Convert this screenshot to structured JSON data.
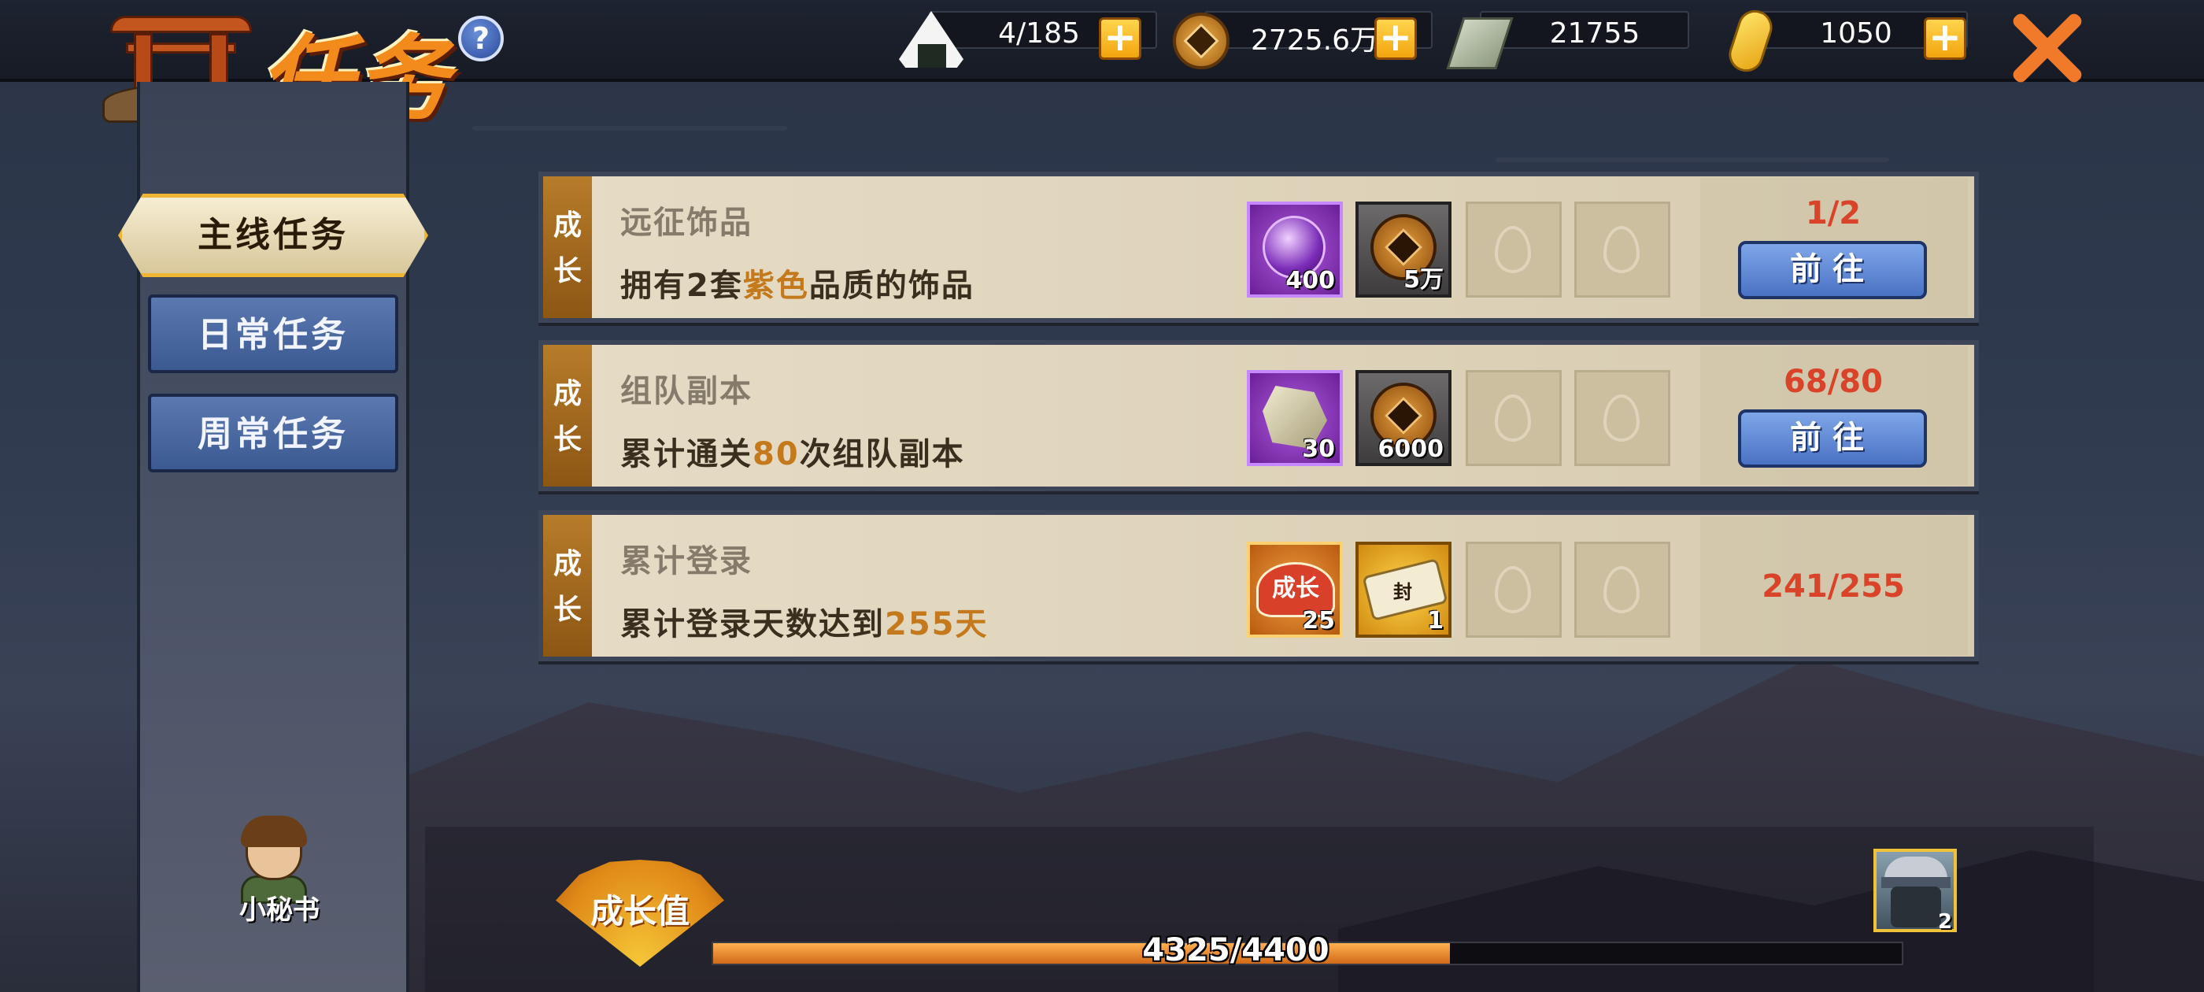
{
  "header": {
    "title": "任务",
    "help_icon": "question-icon",
    "resources": [
      {
        "name": "stamina",
        "icon": "onigiri-icon",
        "value": "4/185",
        "has_plus": true
      },
      {
        "name": "copper",
        "icon": "copper-coin-icon",
        "value": "2725.6万",
        "has_plus": true
      },
      {
        "name": "banknote",
        "icon": "banknote-icon",
        "value": "21755",
        "has_plus": false
      },
      {
        "name": "gold",
        "icon": "gold-ingot-icon",
        "value": "1050",
        "has_plus": true
      }
    ],
    "close_icon": "close-icon"
  },
  "sidebar": {
    "tabs": [
      {
        "label": "主线任务",
        "active": true
      },
      {
        "label": "日常任务",
        "active": false
      },
      {
        "label": "周常任务",
        "active": false
      }
    ],
    "secretary_label": "小秘书"
  },
  "tasks": [
    {
      "category": [
        "成",
        "长"
      ],
      "title": "远征饰品",
      "desc_pre": "拥有2套",
      "desc_hl": "紫色",
      "desc_post": "品质的饰品",
      "rewards": [
        {
          "icon": "purple-orb-icon",
          "count": "400"
        },
        {
          "icon": "copper-coin-icon",
          "count": "5万"
        }
      ],
      "progress": "1/2",
      "button": "前往"
    },
    {
      "category": [
        "成",
        "长"
      ],
      "title": "组队副本",
      "desc_pre": "累计通关",
      "desc_hl": "80",
      "desc_post": "次组队副本",
      "rewards": [
        {
          "icon": "stone-icon",
          "count": "30"
        },
        {
          "icon": "copper-coin-icon",
          "count": "6000"
        }
      ],
      "progress": "68/80",
      "button": "前往"
    },
    {
      "category": [
        "成",
        "长"
      ],
      "title": "累计登录",
      "desc_pre": "累计登录天数达到",
      "desc_hl": "255天",
      "desc_post": "",
      "rewards": [
        {
          "icon": "growth-badge-icon",
          "badge_text": "成长",
          "count": "25"
        },
        {
          "icon": "scroll-icon",
          "scroll_text": "封",
          "count": "1"
        }
      ],
      "progress": "241/255",
      "button": null
    }
  ],
  "growth": {
    "label": "成长值",
    "current": 4325,
    "max": 4400,
    "text": "4325/4400",
    "fill_fraction": 0.62
  },
  "avatar": {
    "count": "2"
  },
  "colors": {
    "highlight": "#c47a1c",
    "progress_red": "#d9432a",
    "button_blue": "#4a72c4",
    "tab_active_border": "#f0b532"
  }
}
